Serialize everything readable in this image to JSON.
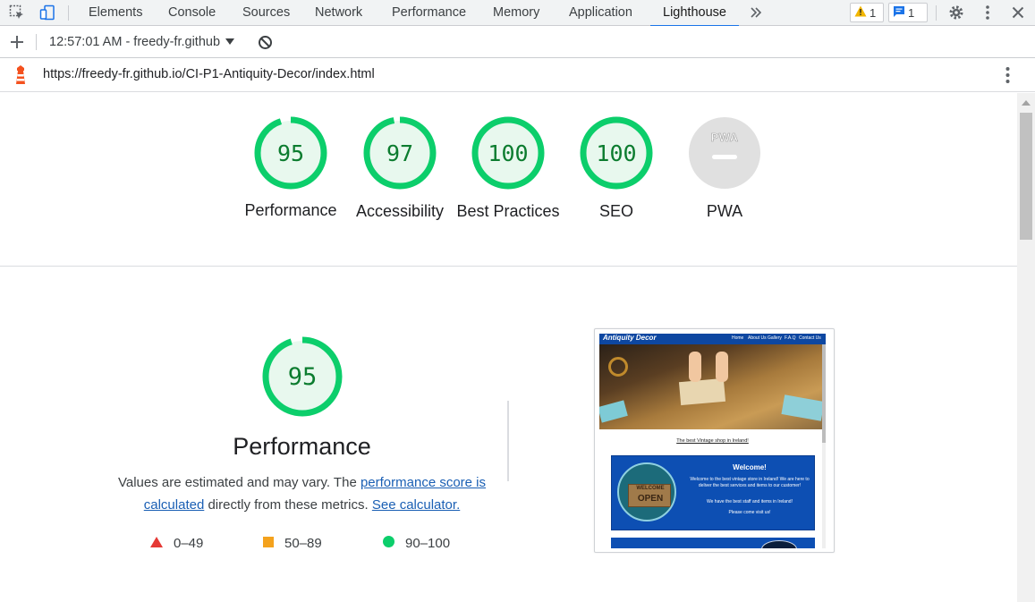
{
  "devtools": {
    "tabs": [
      "Elements",
      "Console",
      "Sources",
      "Network",
      "Performance",
      "Memory",
      "Application",
      "Lighthouse"
    ],
    "active_tab": "Lighthouse",
    "warnings_count": "1",
    "messages_count": "1"
  },
  "toolbar": {
    "report_label": "12:57:01 AM - freedy-fr.github"
  },
  "url": "https://freedy-fr.github.io/CI-P1-Antiquity-Decor/index.html",
  "gauges": [
    {
      "score": "95",
      "label": "Performance",
      "value": 95
    },
    {
      "score": "97",
      "label": "Accessibility",
      "value": 97
    },
    {
      "score": "100",
      "label": "Best Practices",
      "value": 100
    },
    {
      "score": "100",
      "label": "SEO",
      "value": 100
    },
    {
      "score": "",
      "label": "PWA",
      "value": null
    }
  ],
  "pwa_badge": "PWA",
  "performance_section": {
    "score": "95",
    "title": "Performance",
    "desc_part1": "Values are estimated and may vary. The ",
    "link1": "performance score is calculated",
    "desc_part2": " directly from these metrics. ",
    "link2": "See calculator."
  },
  "legend": [
    {
      "range": "0–49",
      "shape": "triangle",
      "color": "#e53935"
    },
    {
      "range": "50–89",
      "shape": "square",
      "color": "#f4a21d"
    },
    {
      "range": "90–100",
      "shape": "circle",
      "color": "#0cce6b"
    }
  ],
  "screenshot": {
    "brand": "Antiquity Decor",
    "nav": [
      "Home",
      "About Us",
      "Gallery",
      "F.A.Q",
      "Contact Us"
    ],
    "tagline": "The best Vintage shop in Ireland!",
    "welcome_title": "Welcome!",
    "welcome_text": "Welcome to the best vintage store in Ireland! We are here to deliver the best services and items to our customer!",
    "welcome_text2": "We have the best staff and items in Ireland!",
    "welcome_text3": "Please come visit us!",
    "sign_line1": "WELCOME",
    "sign_line2": "OPEN"
  },
  "colors": {
    "pass_green": "#0cce6b",
    "pass_text": "#0c7c2f",
    "accent_blue": "#1a73e8"
  }
}
